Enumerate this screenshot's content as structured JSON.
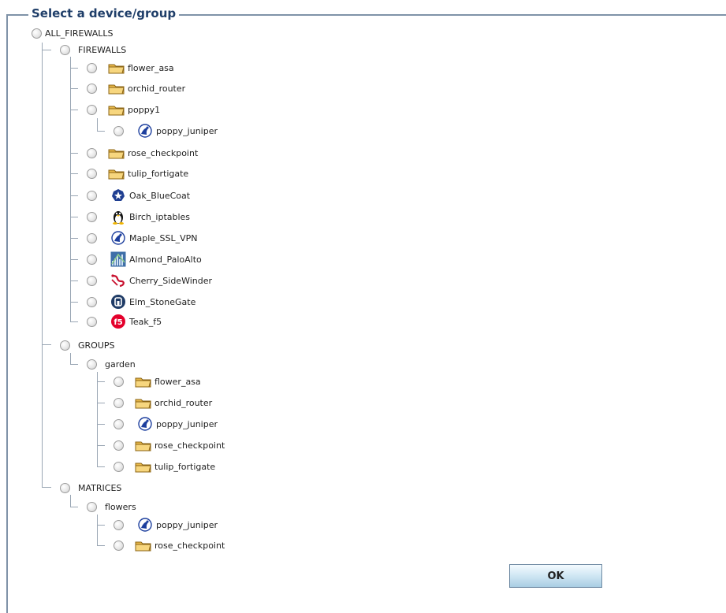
{
  "legend": "Select a device/group",
  "tree": {
    "root": "ALL_FIREWALLS",
    "firewalls": {
      "label": "FIREWALLS",
      "items": [
        {
          "label": "flower_asa",
          "icon": "folder-icon"
        },
        {
          "label": "orchid_router",
          "icon": "folder-icon"
        },
        {
          "label": "poppy1",
          "icon": "folder-icon",
          "children": [
            {
              "label": "poppy_juniper",
              "icon": "juniper-icon"
            }
          ]
        },
        {
          "label": "rose_checkpoint",
          "icon": "folder-icon"
        },
        {
          "label": "tulip_fortigate",
          "icon": "folder-icon"
        },
        {
          "label": "Oak_BlueCoat",
          "icon": "bluecoat-icon"
        },
        {
          "label": "Birch_iptables",
          "icon": "linux-penguin-icon"
        },
        {
          "label": "Maple_SSL_VPN",
          "icon": "juniper-icon"
        },
        {
          "label": "Almond_PaloAlto",
          "icon": "paloalto-icon"
        },
        {
          "label": "Cherry_SideWinder",
          "icon": "sidewinder-icon"
        },
        {
          "label": "Elm_StoneGate",
          "icon": "stonegate-icon"
        },
        {
          "label": "Teak_f5",
          "icon": "f5-icon"
        }
      ]
    },
    "groups": {
      "label": "GROUPS",
      "garden": {
        "label": "garden",
        "items": [
          {
            "label": "flower_asa",
            "icon": "folder-icon"
          },
          {
            "label": "orchid_router",
            "icon": "folder-icon"
          },
          {
            "label": "poppy_juniper",
            "icon": "juniper-icon"
          },
          {
            "label": "rose_checkpoint",
            "icon": "folder-icon"
          },
          {
            "label": "tulip_fortigate",
            "icon": "folder-icon"
          }
        ]
      }
    },
    "matrices": {
      "label": "MATRICES",
      "flowers": {
        "label": "flowers",
        "items": [
          {
            "label": "poppy_juniper",
            "icon": "juniper-icon"
          },
          {
            "label": "rose_checkpoint",
            "icon": "folder-icon"
          }
        ]
      }
    }
  },
  "ok_label": "OK",
  "colors": {
    "legend_text": "#1f3e69",
    "fieldset_border": "#7f92a8",
    "tree_lines": "#9aa6b4",
    "button_top": "#f4fbff",
    "button_bottom": "#a9cde3"
  }
}
